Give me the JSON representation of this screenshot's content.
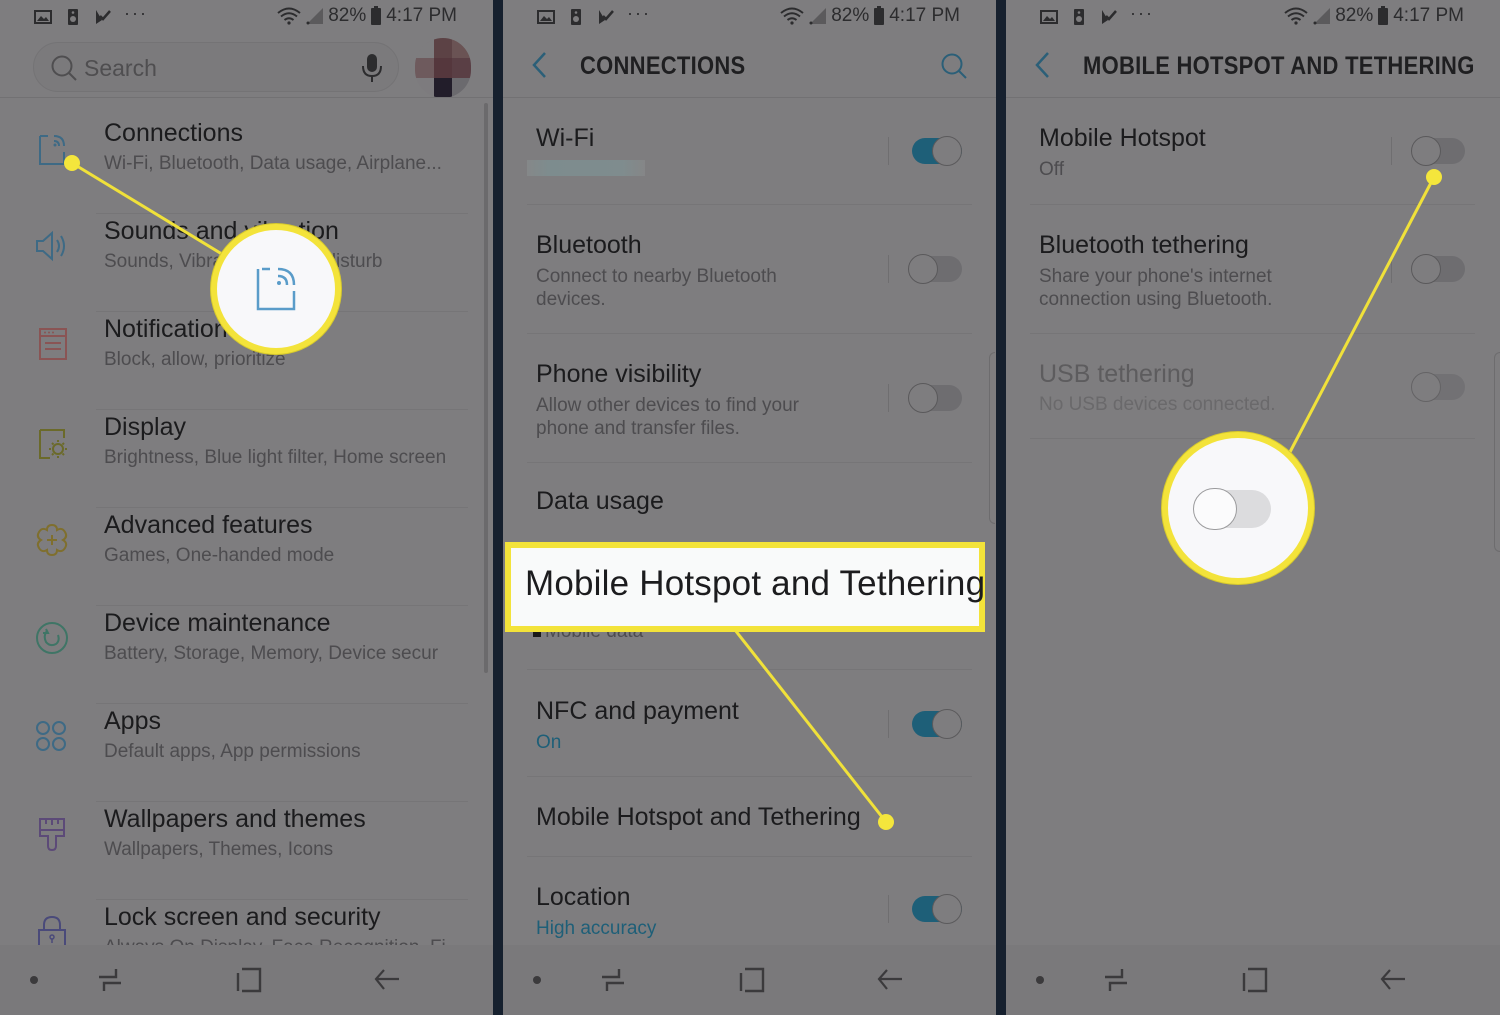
{
  "status_bar": {
    "left_icons": [
      "image-icon",
      "speaker-icon",
      "task-check-icon",
      "more-dots-icon"
    ],
    "more_label": "···",
    "battery": "82%",
    "time": "4:17 PM"
  },
  "settings_panel": {
    "search": {
      "placeholder": "Search"
    },
    "items": [
      {
        "title": "Connections",
        "subtitle": "Wi-Fi, Bluetooth, Data usage, Airplane...",
        "icon": "connections-icon",
        "color": "#3e6a85"
      },
      {
        "title": "Sounds and vibration",
        "subtitle": "Sounds, Vibration, Do not disturb",
        "icon": "speaker-volume-icon",
        "color": "#3e6a85"
      },
      {
        "title": "Notifications",
        "subtitle": "Block, allow, prioritize",
        "icon": "notifications-icon",
        "color": "#8a5454"
      },
      {
        "title": "Display",
        "subtitle": "Brightness, Blue light filter, Home screen",
        "icon": "display-brightness-icon",
        "color": "#6b6a2a"
      },
      {
        "title": "Advanced features",
        "subtitle": "Games, One-handed mode",
        "icon": "advanced-features-icon",
        "color": "#7f6f2e"
      },
      {
        "title": "Device maintenance",
        "subtitle": "Battery, Storage, Memory, Device secur",
        "icon": "device-maintenance-icon",
        "color": "#3f7566"
      },
      {
        "title": "Apps",
        "subtitle": "Default apps, App permissions",
        "icon": "apps-grid-icon",
        "color": "#3e6a85"
      },
      {
        "title": "Wallpapers and themes",
        "subtitle": "Wallpapers, Themes, Icons",
        "icon": "paintbrush-icon",
        "color": "#5c4a78"
      },
      {
        "title": "Lock screen and security",
        "subtitle": "Always On Display, Face Recognition, Fi",
        "icon": "lock-icon",
        "color": "#4a4a7a"
      }
    ]
  },
  "connections_panel": {
    "title": "CONNECTIONS",
    "items": [
      {
        "title": "Wi-Fi",
        "subtitle": "",
        "toggle": true
      },
      {
        "title": "Bluetooth",
        "subtitle": "Connect to nearby Bluetooth",
        "subtitle2": "devices.",
        "toggle": false
      },
      {
        "title": "Phone visibility",
        "subtitle": "Allow other devices to find your",
        "subtitle2": "phone and transfer files.",
        "toggle": false
      },
      {
        "title": "Data usage",
        "subtitle": "Mobile data"
      },
      {
        "title": "NFC and payment",
        "subtitle": "On",
        "toggle": true
      },
      {
        "title": "Mobile Hotspot and Tethering"
      },
      {
        "title": "Location",
        "subtitle": "High accuracy",
        "toggle": true
      }
    ],
    "callout_label": "Mobile Hotspot and Tethering"
  },
  "hotspot_panel": {
    "title": "MOBILE HOTSPOT AND TETHERING",
    "items": [
      {
        "title": "Mobile Hotspot",
        "subtitle": "Off",
        "toggle": false
      },
      {
        "title": "Bluetooth tethering",
        "subtitle": "Share your phone's internet",
        "subtitle2": "connection using Bluetooth.",
        "toggle": false
      },
      {
        "title": "USB tethering",
        "subtitle": "No USB devices connected.",
        "toggle": false,
        "disabled": true
      }
    ]
  },
  "colors": {
    "accent": "#1e5f78",
    "callout_yellow": "#f3e33a",
    "panel_bg": "#7e7d7f",
    "divider": "#16202e"
  }
}
